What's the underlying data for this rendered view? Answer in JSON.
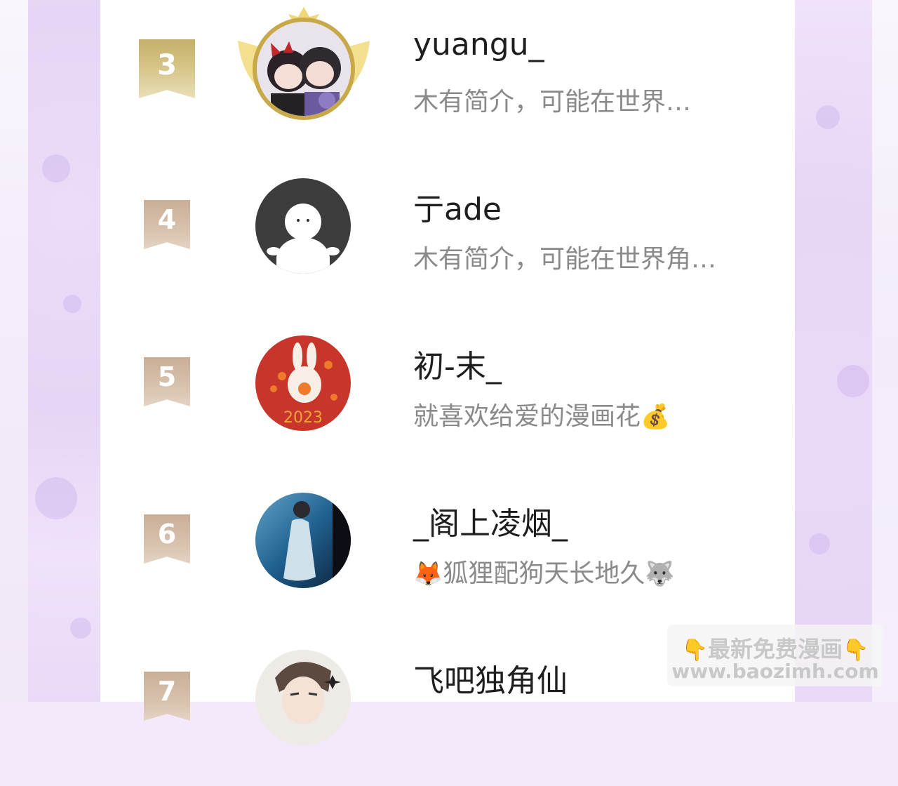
{
  "rows": [
    {
      "rank": "3",
      "name": "yuangu_",
      "bio": "木有简介，可能在世界…",
      "bio_emoji_before": "",
      "bio_emoji_after": "",
      "avatar_icon": "anime-couple-avatar",
      "badge": "gold"
    },
    {
      "rank": "4",
      "name": "亍ade",
      "bio": "木有简介，可能在世界角…",
      "bio_emoji_before": "",
      "bio_emoji_after": "",
      "avatar_icon": "default-ghost-avatar",
      "badge": "tan"
    },
    {
      "rank": "5",
      "name": "初-末_",
      "bio": "就喜欢给爱的漫画花",
      "bio_emoji_before": "",
      "bio_emoji_after": "💰",
      "avatar_icon": "rabbit-2023-avatar",
      "badge": "tan"
    },
    {
      "rank": "6",
      "name": "_阁上凌烟_",
      "bio": "狐狸配狗天长地久",
      "bio_emoji_before": "🦊",
      "bio_emoji_after": "🐺",
      "avatar_icon": "underwater-girl-avatar",
      "badge": "tan"
    },
    {
      "rank": "7",
      "name": "飞吧独角仙",
      "bio": "",
      "bio_emoji_before": "",
      "bio_emoji_after": "",
      "avatar_icon": "anime-boy-avatar",
      "badge": "tan"
    }
  ],
  "watermark": {
    "line1": "最新免费漫画",
    "line1_icon": "👇",
    "line2": "www.baozimh.com"
  },
  "colors": {
    "gold_badge": "#d2c080",
    "tan_badge": "#d3bba6",
    "background_lavender": "#ead9f8",
    "bio_gray": "#8a8a8a"
  }
}
